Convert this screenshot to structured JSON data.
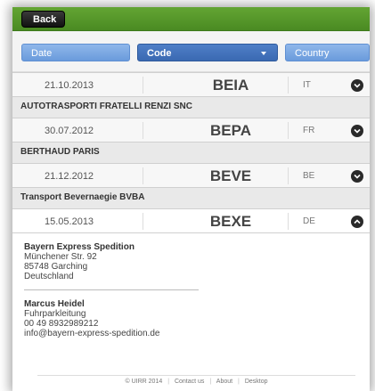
{
  "header": {
    "back_label": "Back"
  },
  "filters": {
    "date": "Date",
    "code": "Code",
    "country": "Country"
  },
  "entries": [
    {
      "date": "21.10.2013",
      "code": "BEIA",
      "country": "IT",
      "company": "AUTOTRASPORTI FRATELLI RENZI SNC",
      "expanded": false
    },
    {
      "date": "30.07.2012",
      "code": "BEPA",
      "country": "FR",
      "company": "BERTHAUD PARIS",
      "expanded": false
    },
    {
      "date": "21.12.2012",
      "code": "BEVE",
      "country": "BE",
      "company": "Transport Bevernaegie BVBA",
      "expanded": false
    },
    {
      "date": "15.05.2013",
      "code": "BEXE",
      "country": "DE",
      "expanded": true
    }
  ],
  "detail": {
    "company_name": "Bayern Express Spedition",
    "street": "Münchener Str. 92",
    "city": "85748 Garching",
    "country": "Deutschland",
    "contact_name": "Marcus Heidel",
    "contact_role": "Fuhrparkleitung",
    "phone": "00 49 8932989212",
    "email": "info@bayern-express-spedition.de"
  },
  "footer": {
    "copyright": "© UIRR 2014",
    "contact": "Contact us",
    "about": "About",
    "desktop": "Desktop"
  },
  "icons": {
    "collapsed": "chevron-down-icon",
    "expanded": "chevron-up-icon"
  }
}
